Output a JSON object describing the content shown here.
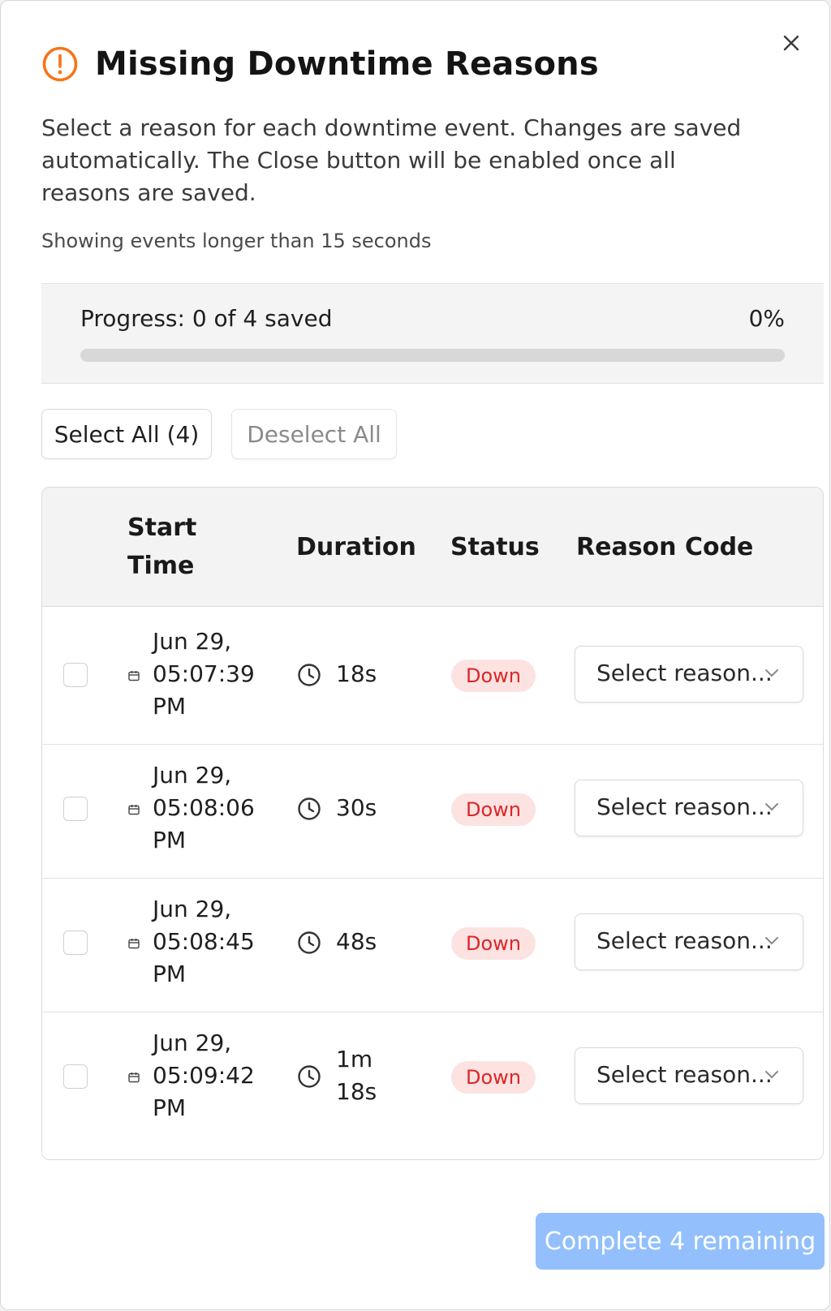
{
  "dialog": {
    "title": "Missing Downtime Reasons",
    "description": "Select a reason for each downtime event. Changes are saved automatically. The Close button will be enabled once all reasons are saved.",
    "filter_note": "Showing events longer than 15 seconds",
    "close_icon": "close-icon",
    "warning_icon": "alert-circle-icon",
    "accent_color": "#f97316"
  },
  "progress": {
    "label": "Progress: 0 of 4 saved",
    "percent_label": "0%",
    "percent": 0
  },
  "actions": {
    "select_all_label": "Select All (4)",
    "deselect_all_label": "Deselect All"
  },
  "table": {
    "headers": {
      "start_time": "Start Time",
      "duration": "Duration",
      "status": "Status",
      "reason_code": "Reason Code"
    },
    "rows": [
      {
        "start_time": "Jun 29, 05:07:39 PM",
        "duration": "18s",
        "status": "Down",
        "reason_placeholder": "Select reason..."
      },
      {
        "start_time": "Jun 29, 05:08:06 PM",
        "duration": "30s",
        "status": "Down",
        "reason_placeholder": "Select reason..."
      },
      {
        "start_time": "Jun 29, 05:08:45 PM",
        "duration": "48s",
        "status": "Down",
        "reason_placeholder": "Select reason..."
      },
      {
        "start_time": "Jun 29, 05:09:42 PM",
        "duration": "1m 18s",
        "status": "Down",
        "reason_placeholder": "Select reason..."
      }
    ]
  },
  "footer": {
    "complete_label": "Complete 4 remaining",
    "complete_color": "#93c0fd"
  },
  "colors": {
    "status_down_bg": "#fde2e2",
    "status_down_text": "#dc2626"
  }
}
